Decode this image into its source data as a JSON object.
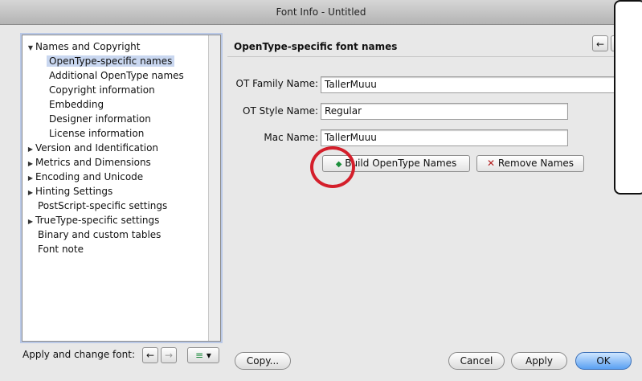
{
  "window": {
    "title": "Font Info - Untitled"
  },
  "sidebar": {
    "items": [
      {
        "label": "Names and Copyright",
        "expanded": true
      },
      {
        "label": "OpenType-specific names",
        "selected": true
      },
      {
        "label": "Additional OpenType names"
      },
      {
        "label": "Copyright information"
      },
      {
        "label": "Embedding"
      },
      {
        "label": "Designer information"
      },
      {
        "label": "License information"
      },
      {
        "label": "Version and Identification",
        "collapsed": true
      },
      {
        "label": "Metrics and Dimensions",
        "collapsed": true
      },
      {
        "label": "Encoding and Unicode",
        "collapsed": true
      },
      {
        "label": "Hinting Settings",
        "collapsed": true
      },
      {
        "label": "PostScript-specific settings"
      },
      {
        "label": "TrueType-specific settings",
        "collapsed": true
      },
      {
        "label": "Binary and custom tables"
      },
      {
        "label": "Font note"
      }
    ]
  },
  "panel": {
    "title": "OpenType-specific font names",
    "fields": [
      {
        "label": "OT Family Name:",
        "value": "TallerMuuu"
      },
      {
        "label": "OT Style Name:",
        "value": "Regular"
      },
      {
        "label": "Mac Name:",
        "value": "TallerMuuu"
      }
    ],
    "build_button": "Build OpenType Names",
    "remove_button": "Remove Names"
  },
  "footer": {
    "apply_change_label": "Apply and change font:",
    "copy_button": "Copy...",
    "cancel_button": "Cancel",
    "apply_button": "Apply",
    "ok_button": "OK"
  },
  "icons": {
    "back": "←",
    "forward": "→",
    "menu": "≡",
    "dropdown": "▾",
    "remove": "✕",
    "build": "◆"
  },
  "colors": {
    "accent_circle": "#d41f2b",
    "selection": "#c9d7f0",
    "ok_blue": "#5aa0f2"
  }
}
